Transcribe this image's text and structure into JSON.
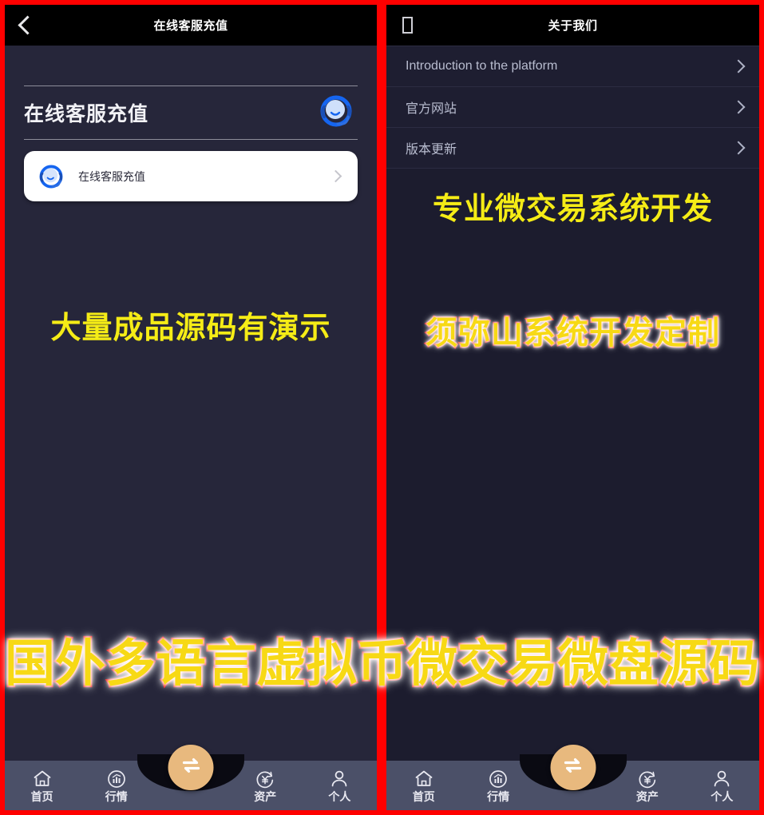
{
  "colors": {
    "frame_border": "#ff0000",
    "header_bg": "#000000",
    "left_panel_bg": "#26263a",
    "right_panel_bg": "#1c1c2e",
    "tabbar_bg": "#4b5068",
    "fab_bg": "#e8b97e",
    "watermark_yellow": "#f5ec16",
    "watermark_outline_red": "#ee1111",
    "card_bg": "#ffffff"
  },
  "left_panel": {
    "header": {
      "back_icon": "chevron-left-icon",
      "title": "在线客服充值"
    },
    "section": {
      "title": "在线客服充值",
      "icon": "headset-support-icon"
    },
    "card": {
      "icon": "headset-support-icon",
      "label": "在线客服充值",
      "chevron": "chevron-right-icon"
    },
    "watermark": "大量成品源码有演示"
  },
  "right_panel": {
    "header": {
      "back_icon": "missing-glyph-box-icon",
      "back_glyph": "",
      "title": "关于我们"
    },
    "list": [
      {
        "label": "Introduction to the platform",
        "chevron": "chevron-right-icon"
      },
      {
        "label": "官方网站",
        "chevron": "chevron-right-icon"
      },
      {
        "label": "版本更新",
        "chevron": "chevron-right-icon"
      }
    ],
    "watermark_top": "专业微交易系统开发",
    "watermark_mid": "须弥山系统开发定制"
  },
  "banner": "国外多语言虚拟币微交易微盘源码",
  "tabbar": {
    "items": [
      {
        "label": "首页",
        "icon": "home-icon"
      },
      {
        "label": "行情",
        "icon": "chart-circle-icon"
      },
      {
        "label": "",
        "icon": "swap-arrows-icon"
      },
      {
        "label": "资产",
        "icon": "yen-refresh-icon"
      },
      {
        "label": "个人",
        "icon": "person-icon"
      }
    ],
    "fab_icon": "swap-arrows-icon"
  }
}
